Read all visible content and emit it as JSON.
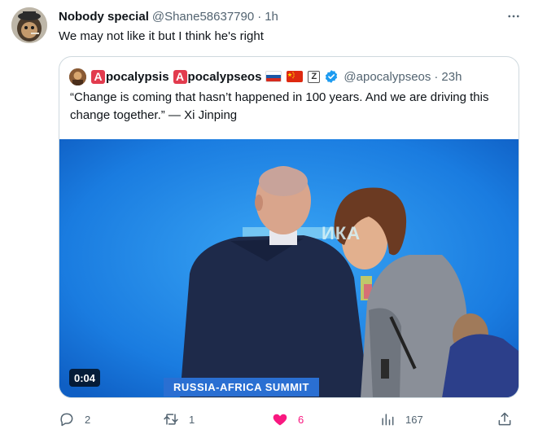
{
  "tweet": {
    "display_name": "Nobody special",
    "handle": "@Shane58637790",
    "separator": "·",
    "time": "1h",
    "text": "We may not like it but I think he's right",
    "more_icon": "more-horizontal-icon"
  },
  "quoted": {
    "badge_letter": "A",
    "name_part1": "pocalypsis",
    "name_part2": "pocalypseos",
    "z_badge": "Z",
    "handle": "@apocalypseos",
    "separator": "·",
    "time": "23h",
    "text": "“Change is coming that hasn’t happened in 100 years. And we are driving this change together.” — Xi Jinping",
    "video": {
      "duration": "0:04",
      "caption": "RUSSIA-AFRICA SUMMIT",
      "backdrop_text": "ИКА"
    }
  },
  "actions": {
    "reply_count": "2",
    "retweet_count": "1",
    "like_count": "6",
    "views_count": "167"
  },
  "colors": {
    "like_active": "#f91880",
    "verified_blue": "#1d9bf0",
    "secondary_text": "#536471",
    "border": "#cfd9de"
  }
}
